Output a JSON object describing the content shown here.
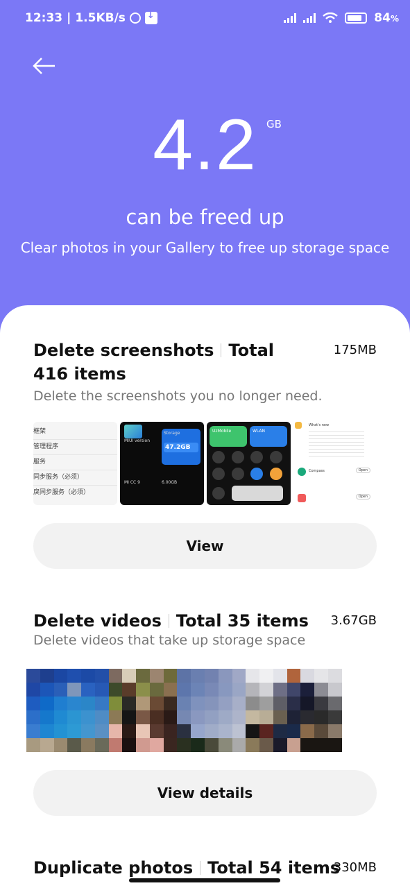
{
  "status_bar": {
    "time": "12:33",
    "net_speed": "1.5KB/s",
    "battery": "84"
  },
  "hero": {
    "amount": "4.2",
    "unit": "GB",
    "headline": "can be freed up",
    "subtitle": "Clear photos in your Gallery to free up storage space",
    "bg_color": "#7b78f6"
  },
  "screenshots_section": {
    "title": "Delete screenshots",
    "count": "Total 416 items",
    "size": "175MB",
    "description": "Delete the screenshots you no longer need.",
    "button": "View",
    "thumbs": {
      "t1_lines": [
        "框架",
        "管理程序",
        "服务",
        "同步服务（必须）",
        "戾同步服务（必须）"
      ],
      "t2_miui": "MIUI version",
      "t2_storage": "Storage",
      "t2_used": "47.2GB",
      "t2_model": "MI CC 9",
      "t2_ram": "6.00GB",
      "t3_a": "UzMobile",
      "t3_b": "WLAN",
      "t4_app": "Compass",
      "t4_open": "Open",
      "t4_whats": "What's new"
    }
  },
  "videos_section": {
    "title": "Delete videos",
    "count": "Total 35 items",
    "size": "3.67GB",
    "description": "Delete videos that take up storage space",
    "button": "View details"
  },
  "duplicates_section": {
    "title": "Duplicate photos",
    "count": "Total 54 items",
    "size": "330MB"
  }
}
